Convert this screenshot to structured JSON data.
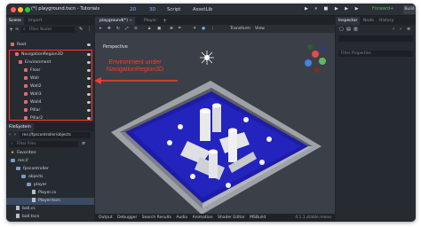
{
  "window": {
    "title": "(*) playground.tscn - Tutorials",
    "menu": [
      "2D",
      "3D",
      "Script",
      "AssetLib"
    ],
    "renderer": "Forward+",
    "build_label": "Build",
    "play_icons": "▶ ⏸ ■ ▶ ▶ ▶",
    "colors": {
      "accent": "#3f8ee8",
      "annotation": "#ff3a2a",
      "floor": "#1c1ca8"
    }
  },
  "scene_dock": {
    "tabs": [
      "Scene",
      "Import"
    ],
    "filter_placeholder": "Filter Nodes",
    "nodes": [
      {
        "label": "Root",
        "icon": "node3d-icon"
      },
      {
        "label": "NavigationRegion3D",
        "icon": "navigation-region-icon"
      },
      {
        "label": "Environment",
        "icon": "node3d-icon"
      },
      {
        "label": "Floor",
        "icon": "mesh-icon"
      },
      {
        "label": "Wall",
        "icon": "mesh-icon"
      },
      {
        "label": "Wall2",
        "icon": "mesh-icon"
      },
      {
        "label": "Wall3",
        "icon": "mesh-icon"
      },
      {
        "label": "Wall4",
        "icon": "mesh-icon"
      },
      {
        "label": "Pillar",
        "icon": "mesh-icon"
      },
      {
        "label": "Pillar2",
        "icon": "mesh-icon"
      }
    ]
  },
  "filesystem": {
    "title": "FileSystem",
    "path": "res://fpscontroller/objects",
    "filter_placeholder": "Filter Files",
    "items": [
      {
        "label": "Favorites:",
        "kind": "star"
      },
      {
        "label": "res://",
        "kind": "folder"
      },
      {
        "label": "fpscontroller",
        "kind": "folder"
      },
      {
        "label": "objects",
        "kind": "folder"
      },
      {
        "label": "player",
        "kind": "folder"
      },
      {
        "label": "Player.cs",
        "kind": "file"
      },
      {
        "label": "Player.tscn",
        "kind": "file"
      },
      {
        "label": "ball.cs",
        "kind": "file"
      },
      {
        "label": "ball.tscn",
        "kind": "file"
      }
    ]
  },
  "editor_tabs": [
    "playground(*)",
    "Player"
  ],
  "viewport": {
    "label": "Perspective",
    "toolbar_right": [
      "Transform",
      "View"
    ]
  },
  "bottom_tabs": [
    "Output",
    "Debugger",
    "Search Results",
    "Audio",
    "Animation",
    "Shader Editor",
    "MSBuild"
  ],
  "version": "4.1.1.stable.mono",
  "inspector": {
    "tabs": [
      "Inspector",
      "Node",
      "History"
    ],
    "filter_placeholder": "Filter Properties"
  },
  "annotation": {
    "line1": "Environment under",
    "line2": "NavigationRegion3D"
  }
}
